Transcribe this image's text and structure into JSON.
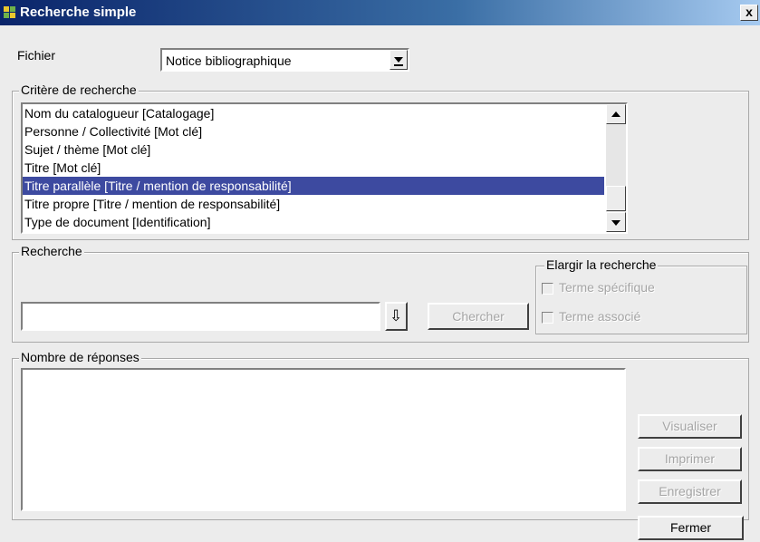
{
  "window": {
    "title": "Recherche simple",
    "close_label": "x"
  },
  "fichier": {
    "label": "Fichier",
    "value": "Notice bibliographique"
  },
  "critere": {
    "legend": "Critère de recherche",
    "items": [
      "Nom du catalogueur [Catalogage]",
      "Personne / Collectivité [Mot clé]",
      "Sujet / thème [Mot clé]",
      "Titre [Mot clé]",
      "Titre parallèle [Titre / mention de responsabilité]",
      "Titre propre [Titre / mention de responsabilité]",
      "Type de document [Identification]"
    ],
    "selected_index": 4
  },
  "recherche": {
    "legend": "Recherche",
    "input_value": "",
    "arrow_glyph": "⇩",
    "search_button": "Chercher",
    "elargir": {
      "legend": "Elargir la recherche",
      "option1": "Terme spécifique",
      "option2": "Terme associé"
    }
  },
  "reponses": {
    "legend": "Nombre de réponses",
    "visualiser": "Visualiser",
    "imprimer": "Imprimer",
    "enregistrer": "Enregistrer"
  },
  "footer": {
    "fermer": "Fermer"
  }
}
